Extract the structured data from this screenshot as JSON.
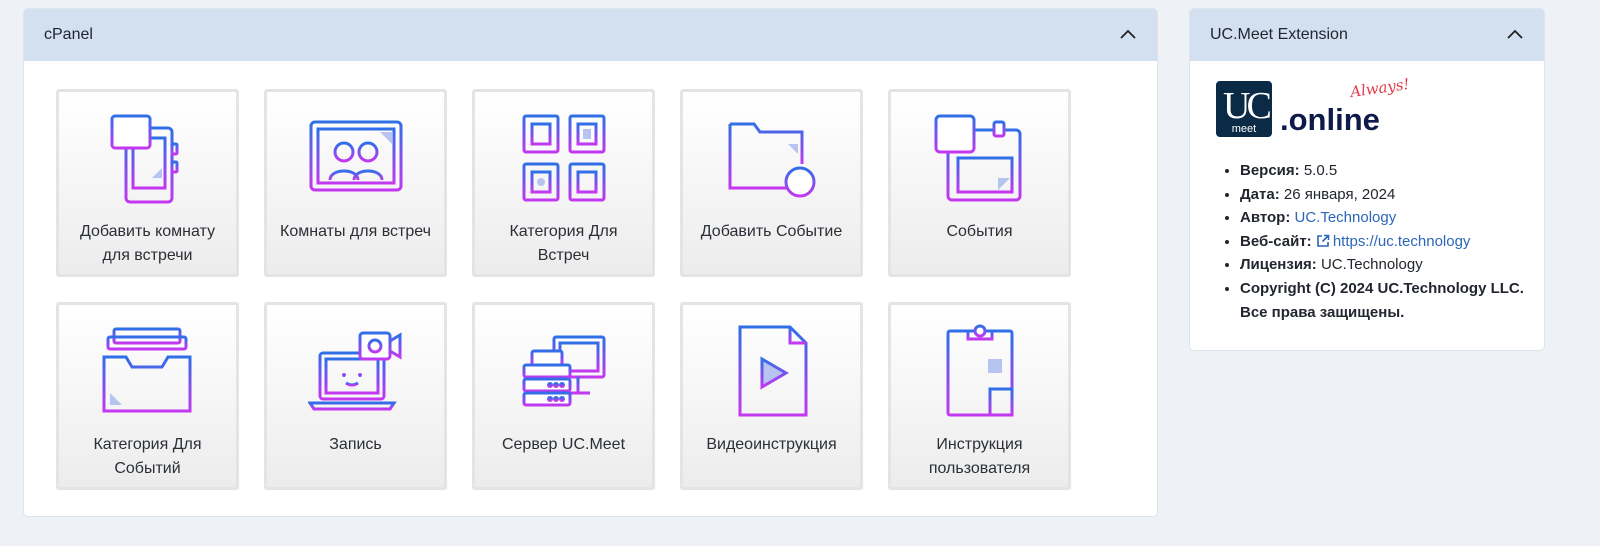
{
  "cpanel": {
    "title": "cPanel",
    "tiles": [
      {
        "label": "Добавить комнату для встречи",
        "icon": "add-room-icon"
      },
      {
        "label": "Комнаты для встреч",
        "icon": "meeting-rooms-icon"
      },
      {
        "label": "Категория Для Встреч",
        "icon": "meeting-category-icon"
      },
      {
        "label": "Добавить Событие",
        "icon": "add-event-folder-icon"
      },
      {
        "label": "События",
        "icon": "events-calendar-icon"
      },
      {
        "label": "Категория Для Событий",
        "icon": "event-category-icon"
      },
      {
        "label": "Запись",
        "icon": "recording-icon"
      },
      {
        "label": "Сервер UC.Meet",
        "icon": "server-icon"
      },
      {
        "label": "Видеоинструкция",
        "icon": "video-instruction-icon"
      },
      {
        "label": "Инструкция пользователя",
        "icon": "user-manual-icon"
      }
    ]
  },
  "extension": {
    "title": "UC.Meet Extension",
    "logo": {
      "uc": "UC",
      "meet": "meet",
      "always": "Always!",
      "online": ".online"
    },
    "info": {
      "version_label": "Версия:",
      "version": "5.0.5",
      "date_label": "Дата:",
      "date": "26 января, 2024",
      "author_label": "Автор:",
      "author": "UC.Technology",
      "website_label": "Веб-сайт:",
      "website": "https://uc.technology",
      "license_label": "Лицензия:",
      "license": "UC.Technology",
      "copyright": "Copyright (C) 2024 UC.Technology LLC. Все права защищены."
    }
  },
  "colors": {
    "header_bg": "#d3e0ef",
    "icon_gradient_top": "#2f6fe8",
    "icon_gradient_bottom": "#c338f0",
    "link": "#2b66b8",
    "logo_bg": "#0a2a45"
  }
}
